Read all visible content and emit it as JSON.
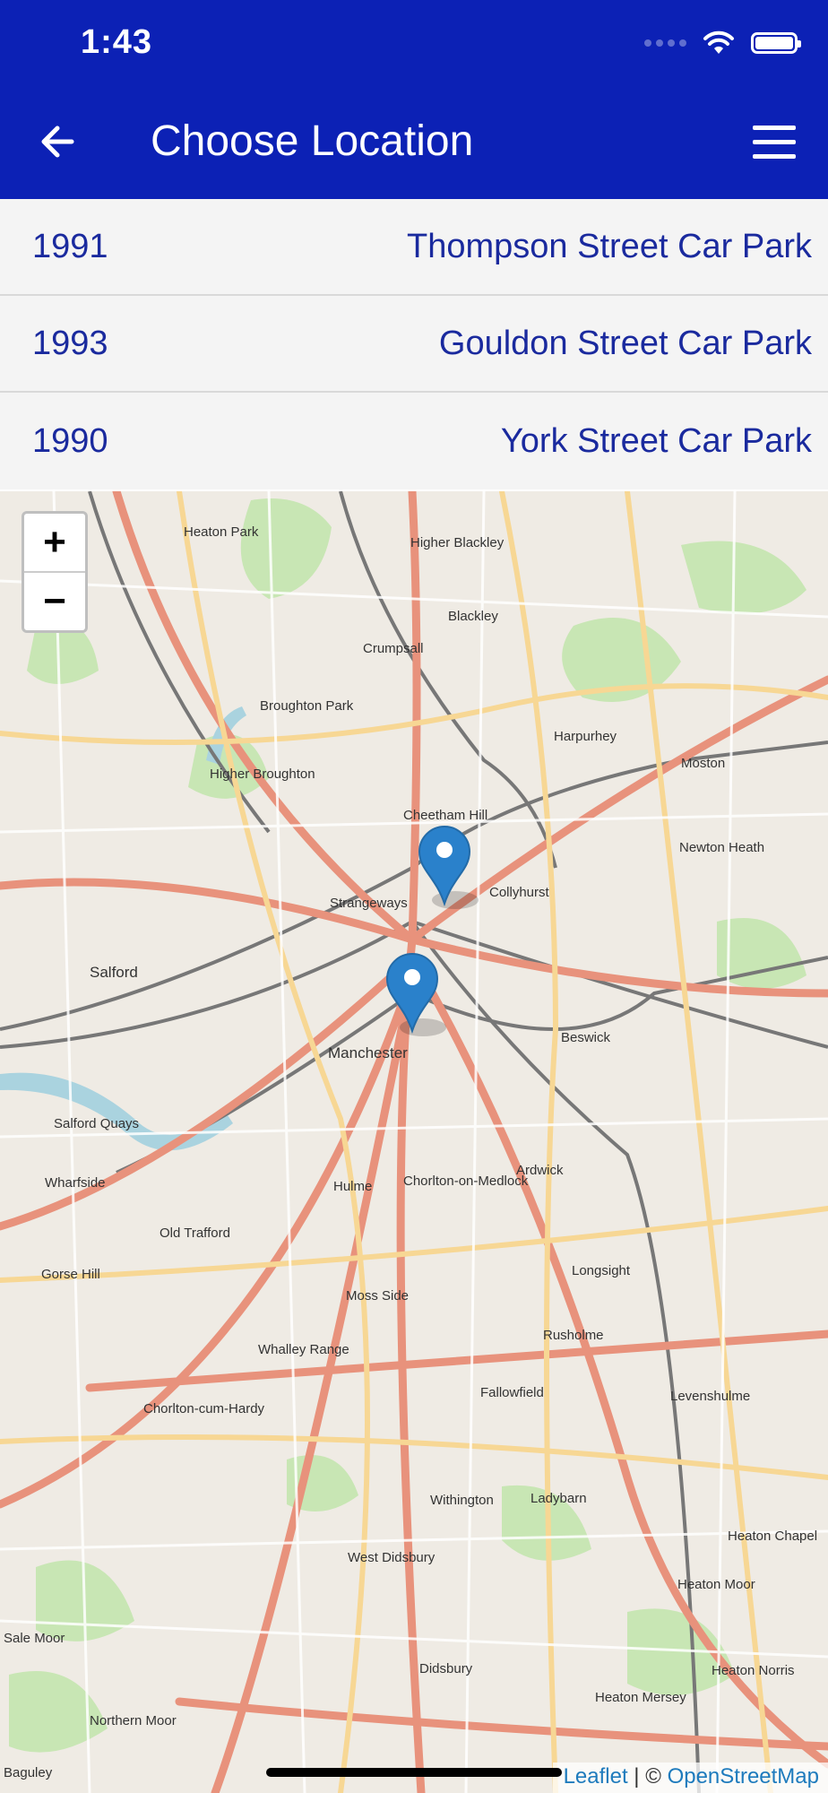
{
  "status_bar": {
    "time": "1:43"
  },
  "header": {
    "title": "Choose Location"
  },
  "locations": [
    {
      "id": "1991",
      "name": "Thompson Street Car Park"
    },
    {
      "id": "1993",
      "name": "Gouldon Street Car Park"
    },
    {
      "id": "1990",
      "name": "York Street Car Park"
    }
  ],
  "map": {
    "zoom_in": "+",
    "zoom_out": "−",
    "attribution_leaflet": "Leaflet",
    "attribution_separator": " | © ",
    "attribution_osm": "OpenStreetMap",
    "place_labels": [
      "Heaton Park",
      "Higher Blackley",
      "Blackley",
      "Crumpsall",
      "Broughton Park",
      "Harpurhey",
      "Moston",
      "Higher Broughton",
      "Cheetham Hill",
      "Newton Heath",
      "Collyhurst",
      "Strangeways",
      "Salford",
      "Beswick",
      "Manchester",
      "Salford Quays",
      "Ardwick",
      "Wharfside",
      "Hulme",
      "Chorlton-on-Medlock",
      "Old Trafford",
      "Longsight",
      "Gorse Hill",
      "Moss Side",
      "Rusholme",
      "Whalley Range",
      "Fallowfield",
      "Levenshulme",
      "Chorlton-cum-Hardy",
      "Withington",
      "Ladybarn",
      "Heaton Chapel",
      "West Didsbury",
      "Heaton Moor",
      "Didsbury",
      "Heaton Norris",
      "Heaton Mersey",
      "Northern Moor",
      "Baguley",
      "Sale Moor"
    ],
    "markers": [
      {
        "name": "marker-collyhurst"
      },
      {
        "name": "marker-city-centre"
      }
    ]
  }
}
